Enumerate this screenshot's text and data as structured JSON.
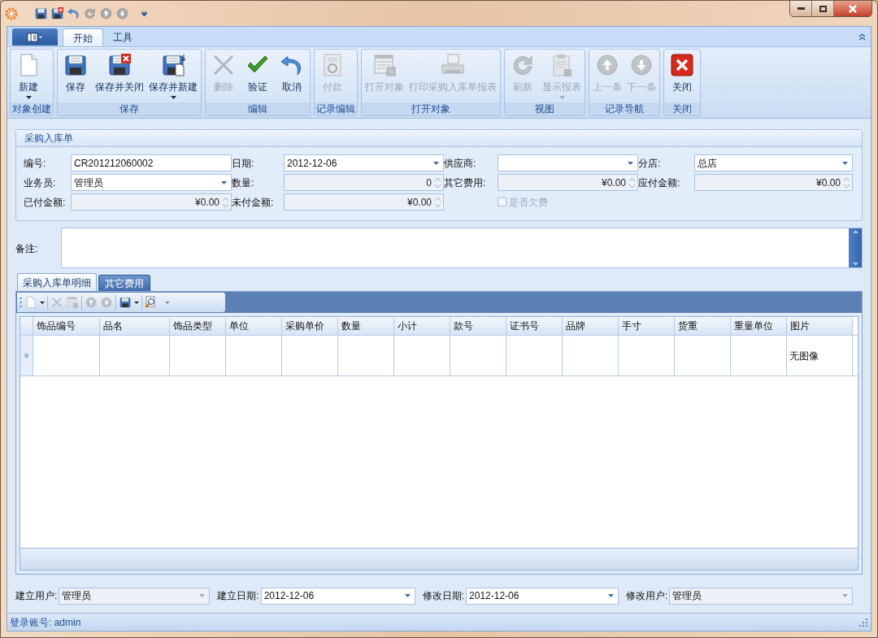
{
  "ribbon": {
    "tabs": [
      {
        "label": "开始",
        "selected": true
      },
      {
        "label": "工具",
        "selected": false
      }
    ],
    "groups": [
      {
        "label": "对象创建",
        "buttons": [
          {
            "label": "新建",
            "disabled": false,
            "dropdown": true
          }
        ]
      },
      {
        "label": "保存",
        "buttons": [
          {
            "label": "保存",
            "disabled": false,
            "dropdown": false
          },
          {
            "label": "保存并关闭",
            "disabled": false,
            "dropdown": false
          },
          {
            "label": "保存并新建",
            "disabled": false,
            "dropdown": true
          }
        ]
      },
      {
        "label": "编辑",
        "buttons": [
          {
            "label": "删除",
            "disabled": true,
            "dropdown": false
          },
          {
            "label": "验证",
            "disabled": false,
            "dropdown": false
          },
          {
            "label": "取消",
            "disabled": false,
            "dropdown": false
          }
        ]
      },
      {
        "label": "记录编辑",
        "buttons": [
          {
            "label": "付款",
            "disabled": true,
            "dropdown": false
          }
        ]
      },
      {
        "label": "打开对象",
        "buttons": [
          {
            "label": "打开对象",
            "disabled": true,
            "dropdown": false
          },
          {
            "label": "打印采购入库单报表",
            "disabled": true,
            "dropdown": false
          }
        ]
      },
      {
        "label": "视图",
        "buttons": [
          {
            "label": "刷新",
            "disabled": true,
            "dropdown": false
          },
          {
            "label": "显示报表",
            "disabled": true,
            "dropdown": true
          }
        ]
      },
      {
        "label": "记录导航",
        "buttons": [
          {
            "label": "上一条",
            "disabled": true,
            "dropdown": false
          },
          {
            "label": "下一条",
            "disabled": true,
            "dropdown": false
          }
        ]
      },
      {
        "label": "关闭",
        "buttons": [
          {
            "label": "关闭",
            "disabled": false,
            "dropdown": false
          }
        ]
      }
    ]
  },
  "form": {
    "title": "采购入库单",
    "fields": [
      {
        "kind": "text",
        "label": "编号:",
        "value": "CR201212060002",
        "disabled": false
      },
      {
        "kind": "combo",
        "label": "日期:",
        "value": "2012-12-06",
        "disabled": false
      },
      {
        "kind": "combo",
        "label": "供应商:",
        "disabled": false
      },
      {
        "kind": "combo",
        "label": "分店:",
        "value": "总店",
        "disabled": false
      },
      {
        "kind": "combo",
        "label": "业务员:",
        "value": "管理员",
        "disabled": false
      },
      {
        "kind": "spin",
        "label": "数量:",
        "value": "0",
        "disabled": true
      },
      {
        "kind": "spin",
        "label": "其它费用:",
        "value": "¥0.00",
        "disabled": true
      },
      {
        "kind": "spin",
        "label": "应付金额:",
        "value": "¥0.00",
        "disabled": true
      },
      {
        "kind": "spin",
        "label": "已付金额:",
        "value": "¥0.00",
        "disabled": true
      },
      {
        "kind": "spin",
        "label": "未付金额:",
        "value": "¥0.00",
        "disabled": true
      },
      {
        "kind": "checkbox",
        "label": "是否欠费",
        "checked": false,
        "disabled": true
      }
    ]
  },
  "remarks": {
    "label": "备注:"
  },
  "detail_tabs": [
    {
      "label": "采购入库单明细",
      "selected": true
    },
    {
      "label": "其它费用",
      "selected": false
    }
  ],
  "grid": {
    "columns": [
      "饰品编号",
      "品名",
      "饰品类型",
      "单位",
      "采购单价",
      "数量",
      "小计",
      "款号",
      "证书号",
      "品牌",
      "手寸",
      "货重",
      "重量单位",
      "图片"
    ],
    "new_row": {
      "image_cell": "无图像"
    }
  },
  "footer_fields": [
    {
      "label": "建立用户:",
      "value": "管理员",
      "disabled": true
    },
    {
      "label": "建立日期:",
      "value": "2012-12-06",
      "disabled": false
    },
    {
      "label": "修改日期:",
      "value": "2012-12-06",
      "disabled": false
    },
    {
      "label": "修改用户:",
      "value": "管理员",
      "disabled": true
    }
  ],
  "status_bar": {
    "text": "登录账号: admin"
  }
}
